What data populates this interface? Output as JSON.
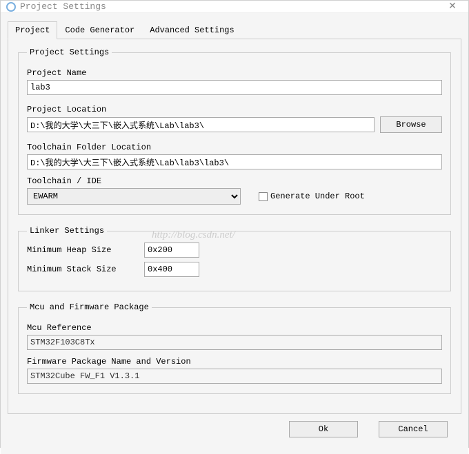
{
  "window": {
    "title": "Project Settings"
  },
  "tabs": [
    {
      "label": "Project",
      "active": true
    },
    {
      "label": "Code Generator",
      "active": false
    },
    {
      "label": "Advanced Settings",
      "active": false
    }
  ],
  "projectSettings": {
    "legend": "Project Settings",
    "projectNameLabel": "Project Name",
    "projectName": "lab3",
    "projectLocationLabel": "Project Location",
    "projectLocation": "D:\\我的大学\\大三下\\嵌入式系统\\Lab\\lab3\\",
    "browseLabel": "Browse",
    "toolchainFolderLabel": "Toolchain Folder Location",
    "toolchainFolder": "D:\\我的大学\\大三下\\嵌入式系统\\Lab\\lab3\\lab3\\",
    "toolchainIdeLabel": "Toolchain / IDE",
    "toolchainIde": "EWARM",
    "generateUnderRootLabel": "Generate Under Root",
    "generateUnderRoot": false
  },
  "linkerSettings": {
    "legend": "Linker Settings",
    "minHeapLabel": "Minimum Heap Size",
    "minHeap": "0x200",
    "minStackLabel": "Minimum Stack Size",
    "minStack": "0x400"
  },
  "mcuSettings": {
    "legend": "Mcu and Firmware Package",
    "mcuRefLabel": "Mcu Reference",
    "mcuRef": "STM32F103C8Tx",
    "fwLabel": "Firmware Package Name and Version",
    "fw": "STM32Cube FW_F1 V1.3.1"
  },
  "footer": {
    "ok": "Ok",
    "cancel": "Cancel"
  },
  "watermark": "http://blog.csdn.net/"
}
